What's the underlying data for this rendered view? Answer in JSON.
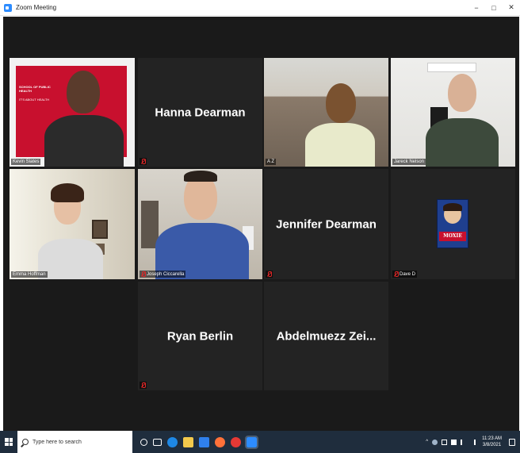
{
  "window": {
    "title": "Zoom Meeting",
    "controls": {
      "minimize": "−",
      "maximize": "□",
      "close": "✕"
    }
  },
  "participants": [
    {
      "name": "Kevin Slates",
      "video": true,
      "muted": false
    },
    {
      "name": "Hanna Dearman",
      "video": false,
      "muted": true
    },
    {
      "name": "A Z",
      "video": true,
      "muted": false
    },
    {
      "name": "Jareck Nelson",
      "video": true,
      "muted": false
    },
    {
      "name": "Emma Hoffman",
      "video": true,
      "muted": false,
      "active_speaker": true
    },
    {
      "name": "Joseph Ciccarella",
      "video": true,
      "muted": true
    },
    {
      "name": "Jennifer Dearman",
      "video": false,
      "muted": true
    },
    {
      "name": "Dave D",
      "video": false,
      "muted": true,
      "avatar_text": "MOXIE"
    },
    {
      "name": "Ryan Berlin",
      "video": false,
      "muted": true
    },
    {
      "name": "Abdelmuezz Zei...",
      "video": false,
      "muted": false
    }
  ],
  "backdrop_text": {
    "line1": "SCHOOL OF PUBLIC HEALTH",
    "line2": "IT'S ABOUT HEALTH"
  },
  "taskbar": {
    "search_placeholder": "Type here to search",
    "time": "11:23 AM",
    "date": "3/8/2021",
    "pinned_icons": [
      "cortana-icon",
      "task-view-icon",
      "edge-icon",
      "file-explorer-icon",
      "store-icon",
      "firefox-icon",
      "chrome-icon",
      "zoom-icon"
    ]
  },
  "colors": {
    "active_speaker_border": "#c9e03b",
    "muted_icon": "#e02828",
    "meeting_bg": "#1a1a1a",
    "tile_bg": "#232323",
    "taskbar_bg": "#1f2d3d"
  }
}
